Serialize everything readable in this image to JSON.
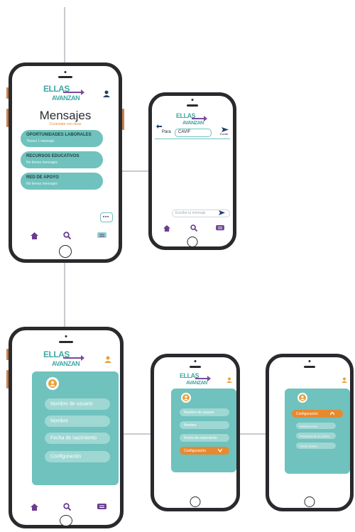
{
  "brand": {
    "line1": "ELLAS",
    "line2": "AVANZAN"
  },
  "messages_screen": {
    "title": "Mensajes",
    "subtitle": "Conectate con otras",
    "groups": [
      {
        "title": "OPORTUNIDADES LABORALES",
        "preview": "Tienes 1 mensaje"
      },
      {
        "title": "RECURSOS EDUCATIVOS",
        "preview": "No tienes mensajes"
      },
      {
        "title": "RED DE APOYO",
        "preview": "No tienes mensajes"
      }
    ]
  },
  "compose_screen": {
    "to_label": "Para",
    "to_value": "CAVIF",
    "send_label": "Enviar",
    "message_placeholder": "Escribe tu mensaje"
  },
  "profile_screen": {
    "fields": [
      "Nombre de usuario",
      "Nombre",
      "Fecha de nacimiento",
      "Configuración"
    ]
  },
  "profile_config_screen": {
    "fields": [
      "Nombre de usuario",
      "Nombre",
      "Fecha de nacimiento"
    ],
    "config_label": "Configuración"
  },
  "config_open_screen": {
    "config_label": "Configuración",
    "options": [
      "Notificaciones",
      "Privacidad de la cuenta",
      "Cerrar Sesión"
    ]
  },
  "colors": {
    "teal": "#6fc2bd",
    "purple": "#6b3d8f",
    "orange": "#e8892f",
    "frame": "#2a2a2e"
  },
  "icons": [
    "home-icon",
    "search-icon",
    "chat-icon",
    "user-icon",
    "back-arrow-icon",
    "send-icon",
    "chevron-down-icon",
    "chevron-up-icon",
    "more-icon"
  ]
}
